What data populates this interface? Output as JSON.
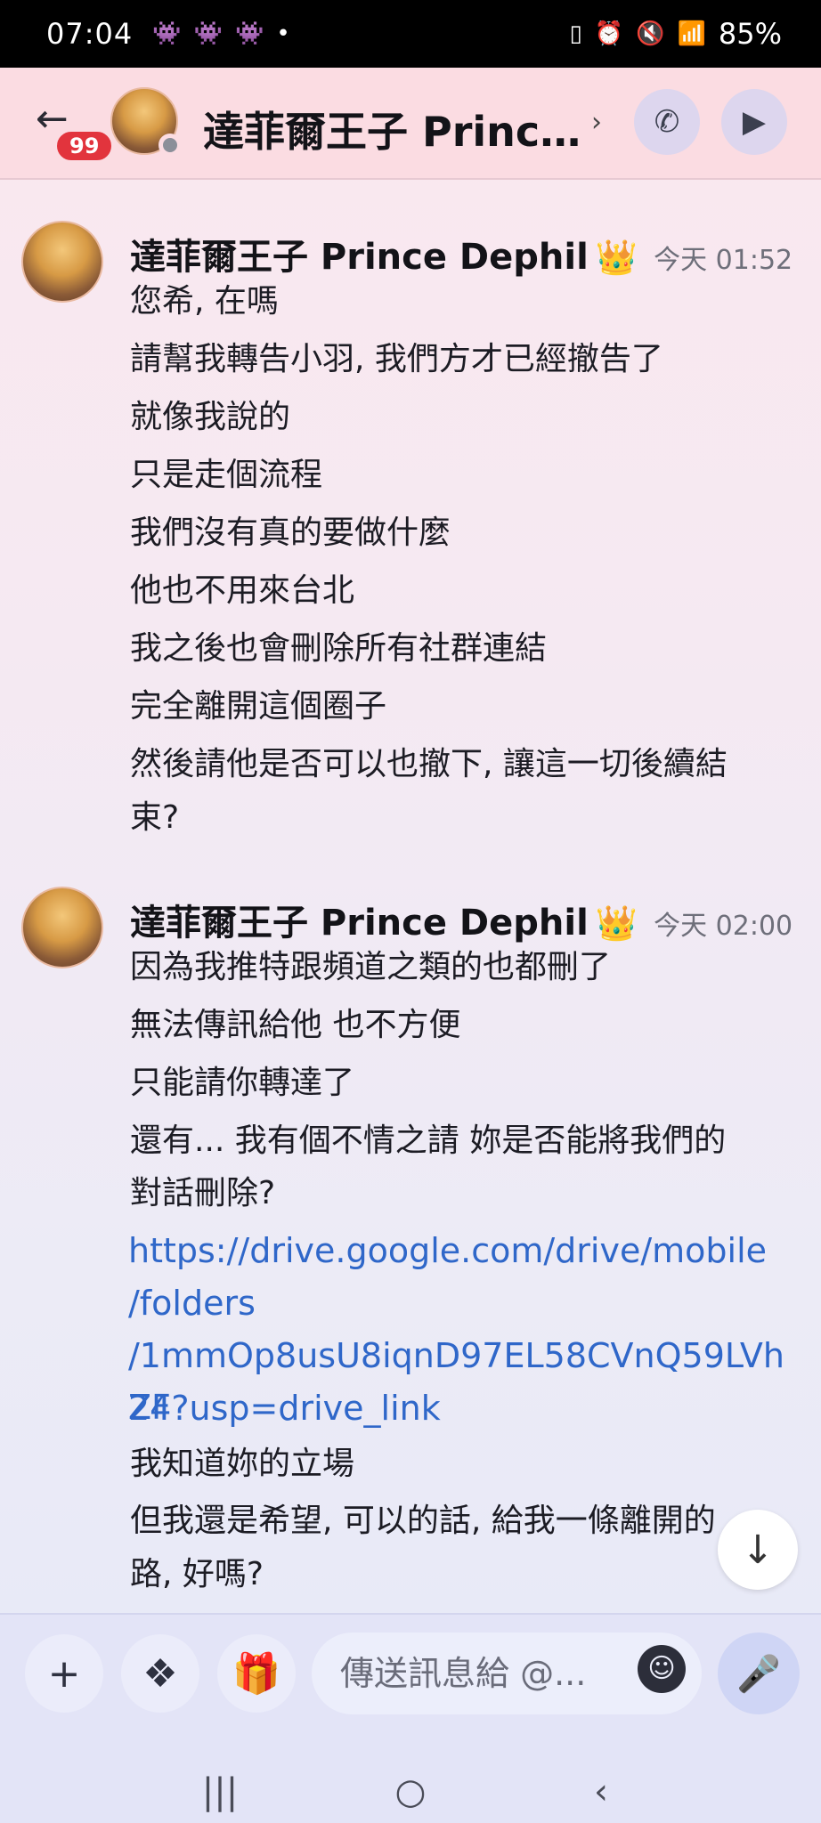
{
  "status_bar": {
    "time": "07:04",
    "left_icons": [
      "discord-icon",
      "discord-icon",
      "discord-icon",
      "dot"
    ],
    "right_icons": [
      "battery-saver-icon",
      "alarm-icon",
      "mute-icon",
      "wifi-icon",
      "volte-icon",
      "signal-icon"
    ],
    "battery": "85%"
  },
  "header": {
    "back_label": "←",
    "unread_count": "99",
    "title": "達菲爾王子 Princ...",
    "chevron": "›",
    "call_icon": "phone-icon",
    "video_icon": "video-icon"
  },
  "messages": [
    {
      "author": "達菲爾王子 Prince Dephil",
      "badge": "👑",
      "time": "今天 01:52",
      "lines": [
        "您希, 在嗎",
        "請幫我轉告小羽, 我們方才已經撤告了",
        "就像我說的",
        "只是走個流程",
        "我們沒有真的要做什麼",
        "他也不用來台北",
        "我之後也會刪除所有社群連結",
        "完全離開這個圈子",
        "然後請他是否可以也撤下, 讓這一切後續結",
        "束?"
      ]
    },
    {
      "author": "達菲爾王子 Prince Dephil",
      "badge": "👑",
      "time": "今天 02:00",
      "lines": [
        "因為我推特跟頻道之類的也都刪了",
        "無法傳訊給他 也不方便",
        "只能請你轉達了",
        "還有... 我有個不情之請 妳是否能將我們的",
        "對話刪除?"
      ],
      "link_lines": [
        "https://drive.google.com/drive/mobile",
        "/folders",
        "/1mmOp8usU8iqnD97EL58CVnQ59LVhZF",
        "24?usp=drive_link"
      ],
      "after_lines": [
        "我知道妳的立場",
        "但我還是希望, 可以的話, 給我一條離開的",
        "路, 好嗎?"
      ]
    }
  ],
  "jump_icon": "arrow-down-icon",
  "composer": {
    "add_icon": "plus-icon",
    "apps_icon": "apps-icon",
    "gift_icon": "gift-icon",
    "placeholder": "傳送訊息給 @...",
    "emoji_icon": "emoji-icon",
    "mic_icon": "microphone-icon"
  },
  "navbar": {
    "recents": "|||",
    "home": "○",
    "back": "‹"
  }
}
